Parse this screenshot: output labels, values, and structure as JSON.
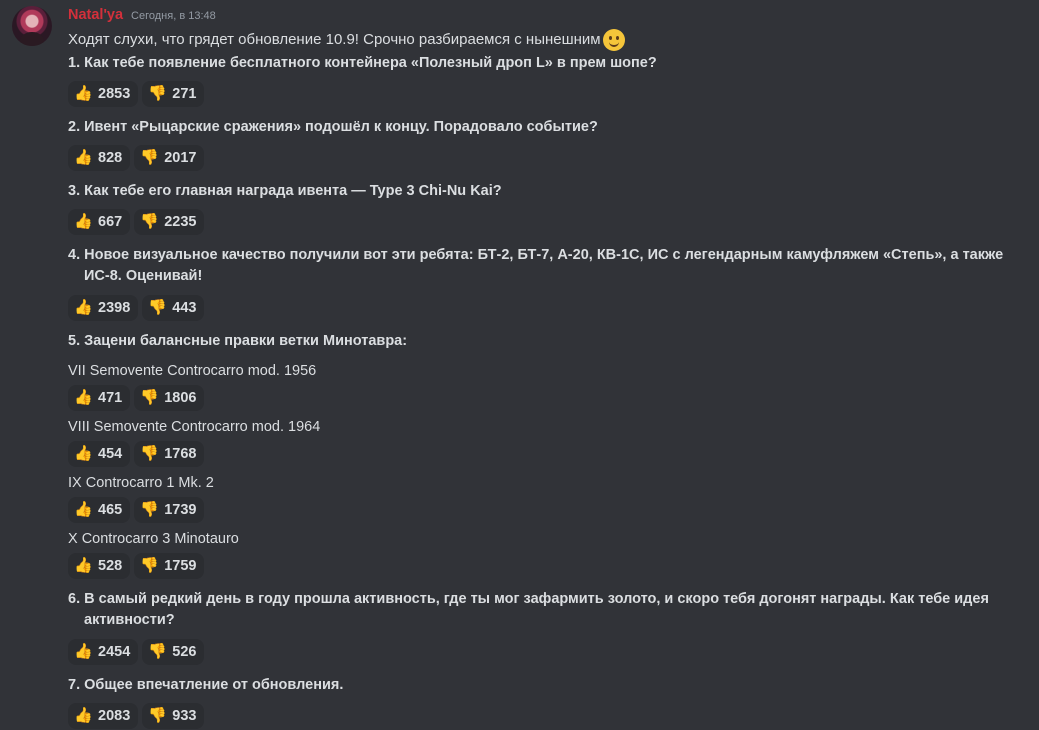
{
  "author": {
    "name": "Natal'ya",
    "timestamp": "Сегодня, в 13:48",
    "name_color": "#d3303b"
  },
  "intro_text": "Ходят слухи, что грядет обновление 10.9! Срочно разбираемся с нынешним",
  "intro_emoji": "slightly-smiling-face-icon",
  "questions": [
    {
      "text": "1. Как тебе появление бесплатного контейнера «Полезный дроп L» в прем шопе?",
      "up": "2853",
      "down": "271"
    },
    {
      "text": "2. Ивент «Рыцарские сражения» подошёл к концу. Порадовало событие?",
      "up": "828",
      "down": "2017"
    },
    {
      "text": "3. Как тебе его главная награда ивента — Type 3 Chi-Nu Kai?",
      "up": "667",
      "down": "2235"
    },
    {
      "text_line1": "4. Новое визуальное качество получили вот эти ребята: БТ-2, БТ-7, А-20, КВ-1С, ИС с легендарным камуфляжем «Степь», а также",
      "text_line2": "ИС-8. Оценивай!",
      "up": "2398",
      "down": "443"
    },
    {
      "text": "5. Зацени балансные правки ветки Минотавра:"
    },
    {
      "text_line1": "6. В самый редкий день в году прошла активность, где ты мог зафармить золото, и скоро тебя догонят награды. Как тебе идея",
      "text_line2": "активности?",
      "up": "2454",
      "down": "526"
    },
    {
      "text": "7. Общее впечатление от обновления.",
      "up": "2083",
      "down": "933"
    }
  ],
  "tanks": [
    {
      "name": "VII Semovente Controcarro mod. 1956",
      "up": "471",
      "down": "1806"
    },
    {
      "name": "VIII Semovente Controcarro mod. 1964",
      "up": "454",
      "down": "1768"
    },
    {
      "name": "IX Controcarro 1 Mk. 2",
      "up": "465",
      "down": "1739"
    },
    {
      "name": "X Controcarro 3 Minotauro",
      "up": "528",
      "down": "1759"
    }
  ],
  "icons": {
    "up": "thumbs-up-icon",
    "down": "thumbs-down-icon",
    "up_glyph": "👍",
    "down_glyph": "👎"
  }
}
